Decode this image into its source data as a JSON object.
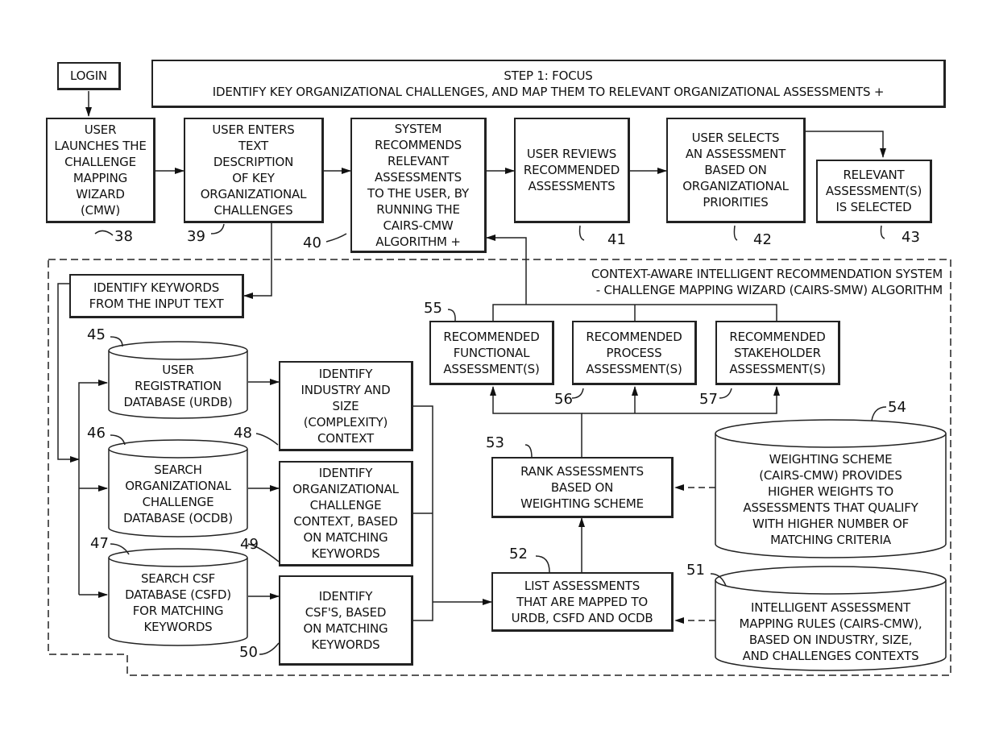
{
  "step_header": {
    "line1": "STEP 1: FOCUS",
    "line2": "IDENTIFY KEY ORGANIZATIONAL CHALLENGES, AND MAP THEM TO RELEVANT ORGANIZATIONAL ASSESSMENTS +"
  },
  "login": {
    "label": "LOGIN"
  },
  "top_flow": [
    {
      "ref": "38",
      "text": "USER\nLAUNCHES THE\nCHALLENGE\nMAPPING\nWIZARD\n(CMW)"
    },
    {
      "ref": "39",
      "text": "USER ENTERS\nTEXT\nDESCRIPTION\nOF KEY\nORGANIZATIONAL\nCHALLENGES"
    },
    {
      "ref": "40",
      "text": "SYSTEM\nRECOMMENDS\nRELEVANT\nASSESSMENTS\nTO THE USER, BY\nRUNNING THE\nCAIRS-CMW\nALGORITHM +"
    },
    {
      "ref": "41",
      "text": "USER REVIEWS\nRECOMMENDED\nASSESSMENTS"
    },
    {
      "ref": "42",
      "text": "USER SELECTS\nAN ASSESSMENT\nBASED ON\nORGANIZATIONAL\nPRIORITIES"
    },
    {
      "ref": "43",
      "text": "RELEVANT\nASSESSMENT(S)\nIS SELECTED"
    }
  ],
  "system": {
    "caption": "CONTEXT-AWARE INTELLIGENT RECOMMENDATION SYSTEM\n- CHALLENGE MAPPING WIZARD (CAIRS-SMW) ALGORITHM",
    "keywords": {
      "text": "IDENTIFY KEYWORDS\nFROM THE INPUT TEXT"
    },
    "databases": [
      {
        "ref": "45",
        "text": "USER\nREGISTRATION\nDATABASE (URDB)"
      },
      {
        "ref": "46",
        "text": "SEARCH\nORGANIZATIONAL\nCHALLENGE\nDATABASE (OCDB)"
      },
      {
        "ref": "47",
        "text": "SEARCH CSF\nDATABASE (CSFD)\nFOR MATCHING\nKEYWORDS"
      }
    ],
    "contexts": [
      {
        "ref": "48",
        "text": "IDENTIFY\nINDUSTRY AND\nSIZE\n(COMPLEXITY)\nCONTEXT"
      },
      {
        "ref": "49",
        "text": "IDENTIFY\nORGANIZATIONAL\nCHALLENGE\nCONTEXT, BASED\nON MATCHING\nKEYWORDS"
      },
      {
        "ref": "50",
        "text": "IDENTIFY\nCSF'S, BASED\nON MATCHING\nKEYWORDS"
      }
    ],
    "mapping_rules": {
      "ref": "51",
      "text": "INTELLIGENT ASSESSMENT\nMAPPING RULES (CAIRS-CMW),\nBASED ON INDUSTRY, SIZE,\nAND CHALLENGES CONTEXTS"
    },
    "list_assessments": {
      "ref": "52",
      "text": "LIST ASSESSMENTS\nTHAT ARE MAPPED TO\nURDB, CSFD AND OCDB"
    },
    "rank_assessments": {
      "ref": "53",
      "text": "RANK ASSESSMENTS\nBASED ON\nWEIGHTING SCHEME"
    },
    "weighting_scheme": {
      "ref": "54",
      "text": "WEIGHTING SCHEME\n(CAIRS-CMW) PROVIDES\nHIGHER WEIGHTS TO\nASSESSMENTS THAT QUALIFY\nWITH HIGHER NUMBER OF\nMATCHING CRITERIA"
    },
    "recommended": [
      {
        "ref": "55",
        "text": "RECOMMENDED\nFUNCTIONAL\nASSESSMENT(S)"
      },
      {
        "ref": "56",
        "text": "RECOMMENDED\nPROCESS\nASSESSMENT(S)"
      },
      {
        "ref": "57",
        "text": "RECOMMENDED\nSTAKEHOLDER\nASSESSMENT(S)"
      }
    ]
  }
}
